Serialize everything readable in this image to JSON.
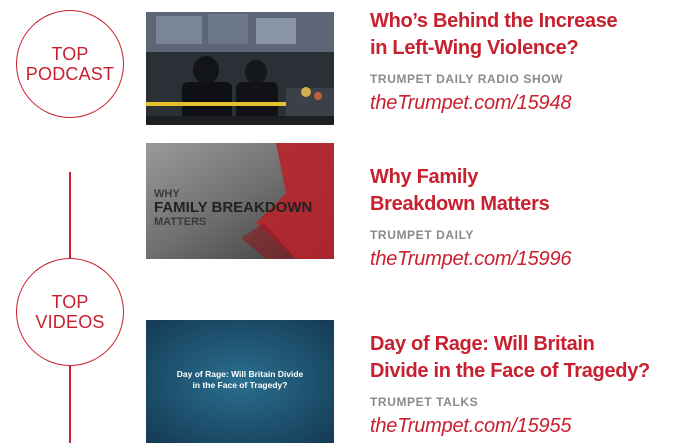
{
  "sections": [
    {
      "label_line1": "TOP",
      "label_line2": "PODCAST"
    },
    {
      "label_line1": "TOP",
      "label_line2": "VIDEOS"
    }
  ],
  "items": [
    {
      "title_line1": "Who’s Behind the Increase",
      "title_line2": "in Left-Wing Violence?",
      "show": "TRUMPET DAILY RADIO SHOW",
      "link": "theTrumpet.com/15948"
    },
    {
      "title_line1": "Why Family",
      "title_line2": "Breakdown Matters",
      "show": "TRUMPET DAILY",
      "link": "theTrumpet.com/15996",
      "thumb_text": [
        "WHY",
        "FAMILY BREAKDOWN",
        "MATTERS"
      ]
    },
    {
      "title_line1": "Day of Rage: Will Britain",
      "title_line2": "Divide in the Face of Tragedy?",
      "show": "TRUMPET TALKS",
      "link": "theTrumpet.com/15955",
      "thumb_text": [
        "Day of Rage: Will Britain Divide",
        "in the Face of Tragedy?"
      ]
    }
  ],
  "colors": {
    "accent": "#c8202f",
    "show_gray": "#8a8a8a"
  }
}
